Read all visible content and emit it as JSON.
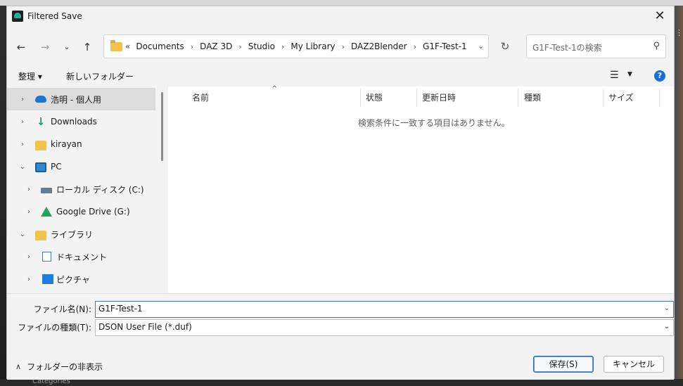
{
  "window": {
    "title": "Filtered Save"
  },
  "address": {
    "overflow": "«",
    "crumbs": [
      "Documents",
      "DAZ 3D",
      "Studio",
      "My Library",
      "DAZ2Blender",
      "G1F-Test-1"
    ]
  },
  "search": {
    "placeholder": "G1F-Test-1の検索"
  },
  "toolbar": {
    "organize": "整理",
    "new_folder": "新しいフォルダー"
  },
  "sidebar": {
    "items": [
      {
        "label": "浩明 - 個人用",
        "icon": "cloud-icon"
      },
      {
        "label": "Downloads",
        "icon": "download-icon"
      },
      {
        "label": "kirayan",
        "icon": "folder-icon"
      },
      {
        "label": "PC",
        "icon": "pc-icon"
      },
      {
        "label": "ローカル ディスク (C:)",
        "icon": "disk-icon"
      },
      {
        "label": "Google Drive (G:)",
        "icon": "gdrive-icon"
      },
      {
        "label": "ライブラリ",
        "icon": "folder-icon"
      },
      {
        "label": "ドキュメント",
        "icon": "document-icon"
      },
      {
        "label": "ピクチャ",
        "icon": "picture-icon"
      }
    ]
  },
  "columns": [
    "名前",
    "状態",
    "更新日時",
    "種類",
    "サイズ"
  ],
  "empty_message": "検索条件に一致する項目はありません。",
  "fields": {
    "filename_label": "ファイル名(N):",
    "filename_value": "G1F-Test-1",
    "filetype_label": "ファイルの種類(T):",
    "filetype_value": "DSON User File (*.duf)"
  },
  "footer": {
    "hide_folders": "フォルダーの非表示",
    "save": "保存(S)",
    "cancel": "キャンセル"
  },
  "background": {
    "panel_label": "Categories"
  },
  "colors": {
    "accent": "#1a6ed8",
    "focus_border": "#3b7ad0",
    "selected_bg": "#dcdcdc"
  }
}
